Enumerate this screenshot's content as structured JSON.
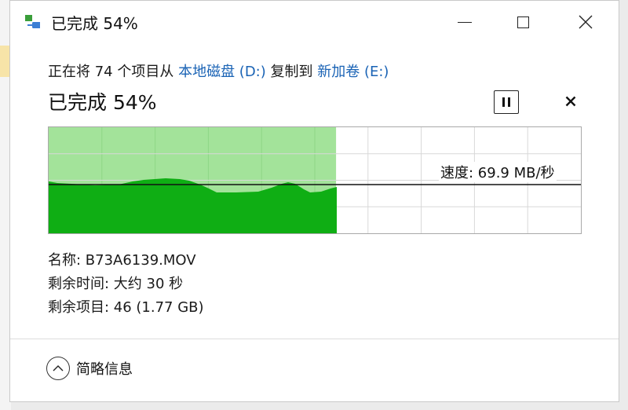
{
  "window": {
    "title": "已完成 54%"
  },
  "transfer": {
    "prefix": "正在将 74 个项目从 ",
    "source": "本地磁盘 (D:)",
    "middle": " 复制到 ",
    "destination": "新加卷 (E:)"
  },
  "progress": {
    "title": "已完成 54%",
    "percent": 54,
    "speed_text": "速度: 69.9 MB/秒"
  },
  "details": {
    "name": "名称: B73A6139.MOV",
    "time_remaining": "剩余时间: 大约 30 秒",
    "items_remaining": "剩余项目: 46 (1.77 GB)"
  },
  "footer": {
    "toggle_label": "简略信息"
  },
  "colors": {
    "progress_fill": "#a3e39a",
    "speed_fill": "#0fae14",
    "link": "#1a63b5",
    "grid": "#d8d8d8"
  },
  "icons": [
    "copy-arrow-icon",
    "minimize-icon",
    "maximize-icon",
    "close-icon",
    "pause-icon",
    "cancel-icon",
    "chevron-up-icon"
  ]
}
